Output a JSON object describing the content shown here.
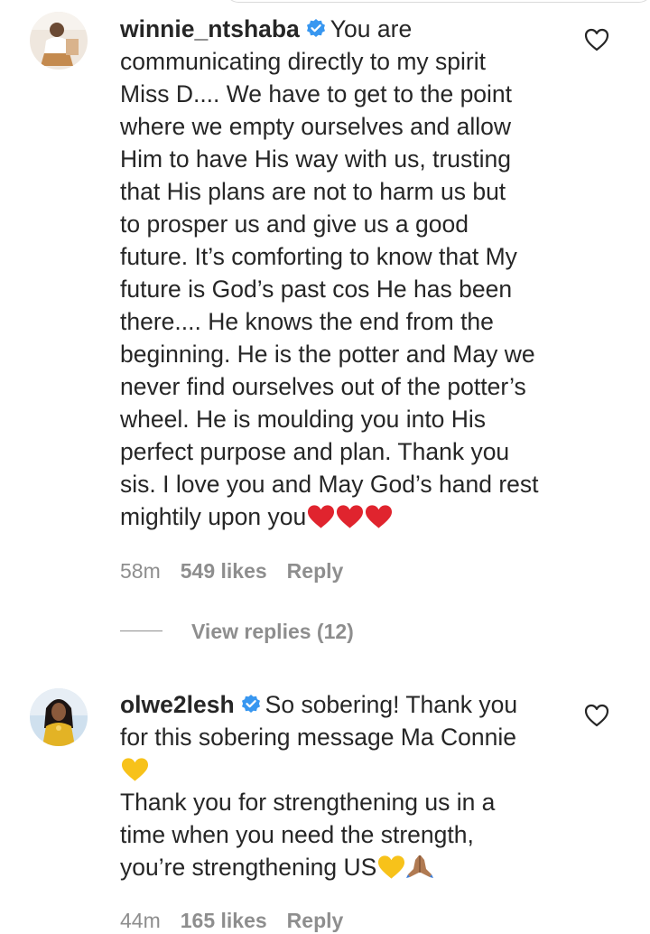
{
  "comments": [
    {
      "username": "winnie_ntshaba",
      "verified": true,
      "text_lines": [
        "You are",
        "communicating directly to my spirit",
        "Miss D.... We have to get to the point",
        "where we empty ourselves and allow",
        "Him to have His way with us, trusting",
        "that His plans are not to harm us but",
        "to prosper us and give us a good",
        "future. It’s comforting to know that My",
        "future is God’s past cos He has been",
        "there.... He knows the end from the",
        "beginning. He is the potter and May we",
        "never find ourselves out of the potter’s",
        "wheel. He is moulding you into His",
        "perfect purpose and plan. Thank you",
        "sis. I love you and May God’s hand rest",
        "mightily upon you"
      ],
      "trailing_emoji": [
        "red-heart",
        "red-heart",
        "red-heart"
      ],
      "time": "58m",
      "likes": "549 likes",
      "reply_label": "Reply",
      "view_replies": "View replies (12)"
    },
    {
      "username": "olwe2lesh",
      "verified": true,
      "text_line1": "So sobering! Thank you",
      "text_line2": "for this sobering message Ma Connie",
      "line3_emoji": "yellow-heart",
      "text_line4": "Thank you for strengthening us in a",
      "text_line5": "time when you need the strength,",
      "text_line6": "you’re strengthening US",
      "trailing_emoji": [
        "yellow-heart",
        "folded-hands"
      ],
      "time": "44m",
      "likes": "165 likes",
      "reply_label": "Reply"
    }
  ],
  "colors": {
    "text": "#262626",
    "meta": "#8e8e8e",
    "verified_blue": "#3897f0",
    "red_heart": "#e0242e",
    "yellow_heart": "#f7c21a"
  }
}
